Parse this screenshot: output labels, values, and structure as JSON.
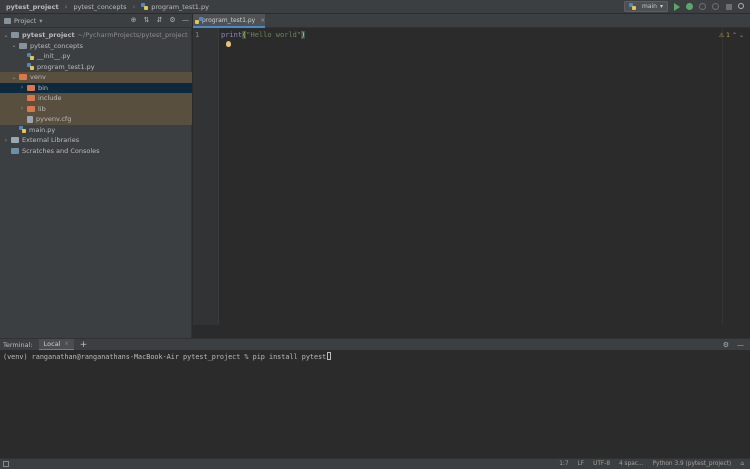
{
  "navbar": {
    "breadcrumbs": [
      "pytest_project",
      "pytest_concepts",
      "program_test1.py"
    ],
    "run_config": "main"
  },
  "project_panel": {
    "title": "Project",
    "tree": [
      {
        "label": "pytest_project",
        "path": "~/PycharmProjects/pytest_project",
        "icon": "folder-icon"
      },
      {
        "label": "pytest_concepts",
        "icon": "folder-icon"
      },
      {
        "label": "__init__.py",
        "icon": "python-file-icon"
      },
      {
        "label": "program_test1.py",
        "icon": "python-file-icon"
      },
      {
        "label": "venv",
        "icon": "folder-icon"
      },
      {
        "label": "bin",
        "icon": "folder-icon"
      },
      {
        "label": "include",
        "icon": "folder-icon"
      },
      {
        "label": "lib",
        "icon": "folder-icon"
      },
      {
        "label": "pyvenv.cfg",
        "icon": "file-icon"
      },
      {
        "label": "main.py",
        "icon": "python-file-icon"
      },
      {
        "label": "External Libraries",
        "icon": "library-icon"
      },
      {
        "label": "Scratches and Consoles",
        "icon": "scratches-icon"
      }
    ]
  },
  "editor": {
    "tab_label": "program_test1.py",
    "line_number": "1",
    "code_keyword": "print",
    "code_open": "(",
    "code_string": "\"Hello world\"",
    "code_close": ")",
    "warning_count": "1"
  },
  "terminal": {
    "title": "Terminal:",
    "tab_label": "Local",
    "command_line": "(venv) ranganathan@ranganathans-MacBook-Air pytest_project % pip install pytest"
  },
  "statusbar": {
    "position": "1:7",
    "line_sep": "LF",
    "encoding": "UTF-8",
    "indent": "4 spac...",
    "interpreter": "Python 3.9 (pytest_project)"
  },
  "colors": {
    "accent": "#4a88c7",
    "excluded_bg": "#594f3e",
    "selected_bg": "#0d293e",
    "run_green": "#59a869"
  }
}
